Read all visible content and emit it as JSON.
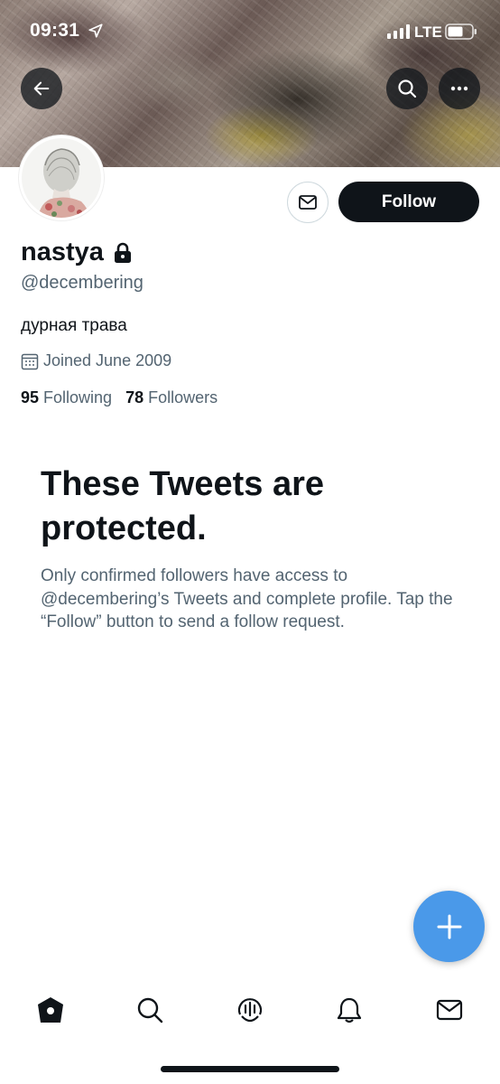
{
  "status_bar": {
    "time": "09:31",
    "network": "LTE"
  },
  "profile": {
    "name": "nastya",
    "handle": "@decembering",
    "bio": "дурная трава",
    "joined": "Joined June 2009",
    "following_count": "95",
    "following_label": "Following",
    "followers_count": "78",
    "followers_label": "Followers"
  },
  "actions": {
    "follow_label": "Follow"
  },
  "protected": {
    "title": "These Tweets are protected.",
    "text": "Only confirmed followers have access to @decembering’s Tweets and complete profile. Tap the “Follow” button to send a follow request."
  },
  "bottom_nav": [
    {
      "icon": "home-icon"
    },
    {
      "icon": "search-icon"
    },
    {
      "icon": "spaces-icon"
    },
    {
      "icon": "notifications-icon"
    },
    {
      "icon": "messages-icon"
    }
  ],
  "colors": {
    "follow_button": "#0f1419",
    "fab": "#4a99e9",
    "secondary_text": "#536471"
  }
}
